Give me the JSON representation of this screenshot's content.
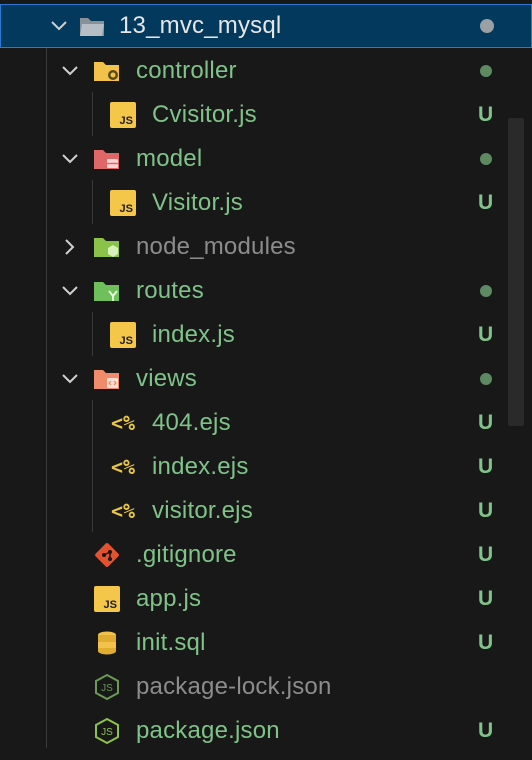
{
  "explorer": {
    "root": {
      "label": "13_mvc_mysql",
      "icon": "folder-open-icon",
      "chevron": "chevron-down-icon"
    },
    "items": [
      {
        "label": "controller",
        "type": "folder",
        "icon": "folder-controller-icon",
        "expanded": true,
        "status": "modified-dot"
      },
      {
        "label": "Cvisitor.js",
        "type": "file",
        "icon": "js-file-icon",
        "status": "U"
      },
      {
        "label": "model",
        "type": "folder",
        "icon": "folder-model-icon",
        "expanded": true,
        "status": "modified-dot"
      },
      {
        "label": "Visitor.js",
        "type": "file",
        "icon": "js-file-icon",
        "status": "U"
      },
      {
        "label": "node_modules",
        "type": "folder",
        "icon": "folder-node-icon",
        "expanded": false,
        "status": ""
      },
      {
        "label": "routes",
        "type": "folder",
        "icon": "folder-routes-icon",
        "expanded": true,
        "status": "modified-dot"
      },
      {
        "label": "index.js",
        "type": "file",
        "icon": "js-file-icon",
        "status": "U"
      },
      {
        "label": "views",
        "type": "folder",
        "icon": "folder-views-icon",
        "expanded": true,
        "status": "modified-dot"
      },
      {
        "label": "404.ejs",
        "type": "file",
        "icon": "ejs-file-icon",
        "icon_text": "<%",
        "status": "U"
      },
      {
        "label": "index.ejs",
        "type": "file",
        "icon": "ejs-file-icon",
        "icon_text": "<%",
        "status": "U"
      },
      {
        "label": "visitor.ejs",
        "type": "file",
        "icon": "ejs-file-icon",
        "icon_text": "<%",
        "status": "U"
      },
      {
        "label": ".gitignore",
        "type": "file",
        "icon": "git-icon",
        "status": "U"
      },
      {
        "label": "app.js",
        "type": "file",
        "icon": "js-file-icon",
        "status": "U"
      },
      {
        "label": "init.sql",
        "type": "file",
        "icon": "database-icon",
        "status": "U"
      },
      {
        "label": "package-lock.json",
        "type": "file",
        "icon": "nodejs-icon",
        "status": ""
      },
      {
        "label": "package.json",
        "type": "file",
        "icon": "nodejs-icon",
        "status": "U"
      }
    ],
    "js_badge_text": "JS"
  },
  "colors": {
    "background": "#181818",
    "selection": "#04395e",
    "untracked": "#7fc389",
    "ignored": "#8c8c8c"
  }
}
